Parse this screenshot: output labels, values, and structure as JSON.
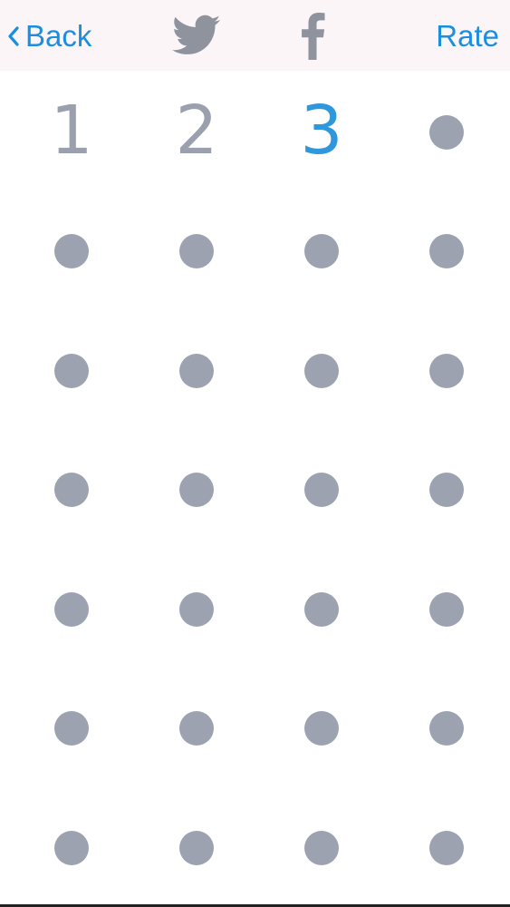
{
  "nav": {
    "back_label": "Back",
    "rate_label": "Rate",
    "share_icons": [
      "twitter-bird-icon",
      "facebook-f-icon"
    ]
  },
  "colors": {
    "accent": "#1a8fdf",
    "active_number": "#2f97dc",
    "inactive": "#9da2b0",
    "navbar_bg": "#fbf5f7"
  },
  "grid": {
    "columns": 4,
    "rows": 7,
    "revealed_numbers": [
      "1",
      "2",
      "3"
    ],
    "active_number": "3",
    "hidden_cells": 25
  }
}
